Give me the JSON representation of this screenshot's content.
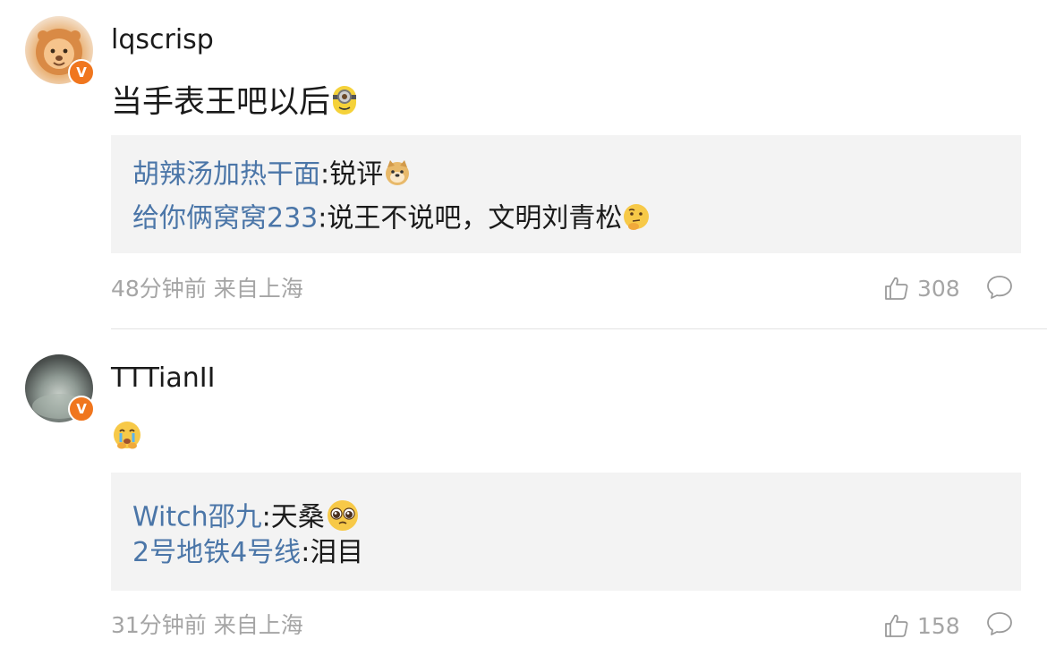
{
  "comments": [
    {
      "username": "lqscrisp",
      "avatar_icon": "lion-avatar",
      "badge": "V",
      "content": "当手表王吧以后",
      "content_emoji": "minion-emoji",
      "replies": [
        {
          "name": "胡辣汤加热干面",
          "text": ":锐评",
          "emoji": "doge-emoji"
        },
        {
          "name": "给你俩窝窝233",
          "text": ":说王不说吧，文明刘青松",
          "emoji": "thinking-emoji"
        }
      ],
      "time_location": "48分钟前 来自上海",
      "likes": "308"
    },
    {
      "username": "TTTianII",
      "avatar_icon": "gray-avatar",
      "badge": "V",
      "content": "",
      "content_emoji": "crying-emoji",
      "replies": [
        {
          "name": "Witch邵九",
          "text": ":天桑",
          "emoji": "pleading-emoji"
        },
        {
          "name": "2号地铁4号线",
          "text": ":泪目",
          "emoji": ""
        }
      ],
      "time_location": "31分钟前 来自上海",
      "likes": "158"
    }
  ],
  "colors": {
    "link_blue": "#4b76a8",
    "meta_gray": "#a5a5a5",
    "badge_orange": "#f0761e",
    "reply_bg": "#f3f3f3"
  }
}
